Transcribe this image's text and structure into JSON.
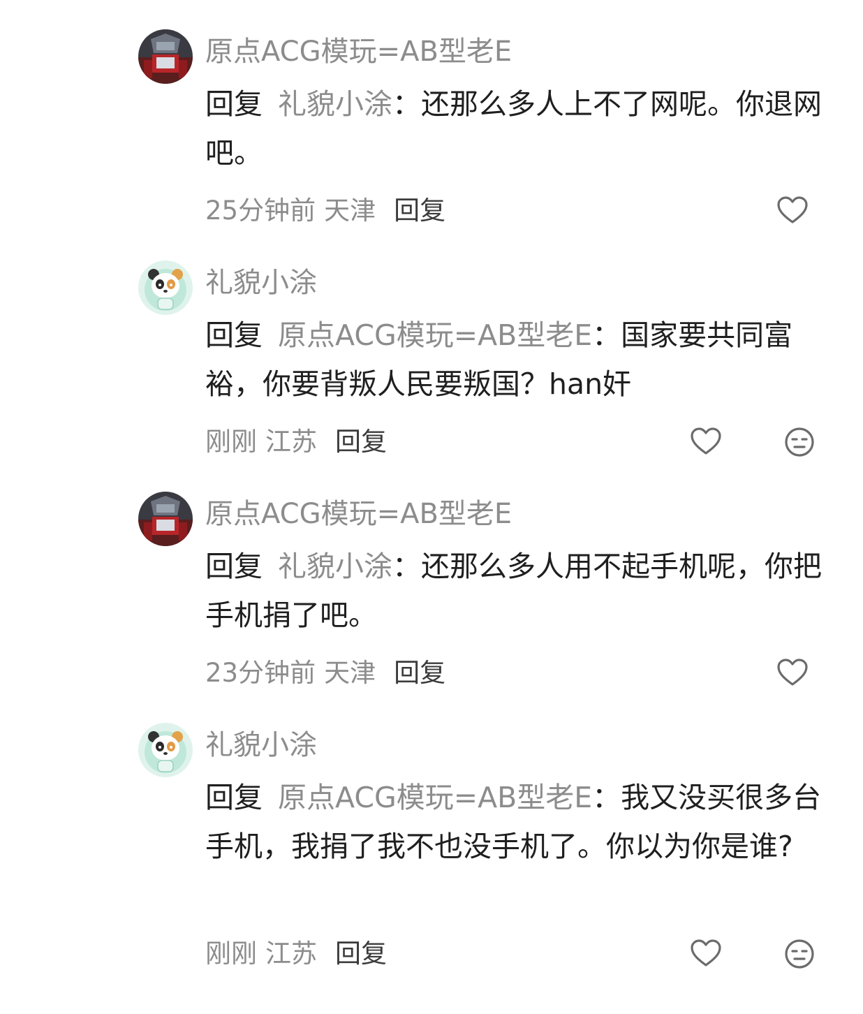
{
  "comments": [
    {
      "username": "原点ACG模玩=AB型老E",
      "reply_word": "回复",
      "reply_target": "礼貌小涂",
      "sep": "：",
      "text": "还那么多人上不了网呢。你退网吧。",
      "time": "25分钟前",
      "location": "天津",
      "reply_label": "回复"
    },
    {
      "username": "礼貌小涂",
      "reply_word": "回复",
      "reply_target": "原点ACG模玩=AB型老E",
      "sep": "：",
      "text": "国家要共同富裕，你要背叛人民要叛国？han奸",
      "time": "刚刚",
      "location": "江苏",
      "reply_label": "回复"
    },
    {
      "username": "原点ACG模玩=AB型老E",
      "reply_word": "回复",
      "reply_target": "礼貌小涂",
      "sep": "：",
      "text": "还那么多人用不起手机呢，你把手机捐了吧。",
      "time": "23分钟前",
      "location": "天津",
      "reply_label": "回复"
    },
    {
      "username": "礼貌小涂",
      "reply_word": "回复",
      "reply_target": "原点ACG模玩=AB型老E",
      "sep": "：",
      "text": "我又没买很多台手机，我捐了我不也没手机了。你以为你是谁?",
      "time": "刚刚",
      "location": "江苏",
      "reply_label": "回复"
    }
  ],
  "icons": {
    "like": "heart-outline-icon",
    "dislike": "meh-face-icon"
  },
  "colors": {
    "text_primary": "#1f1f1f",
    "text_secondary": "#8c8c8c",
    "icon": "#6b6b6b"
  }
}
